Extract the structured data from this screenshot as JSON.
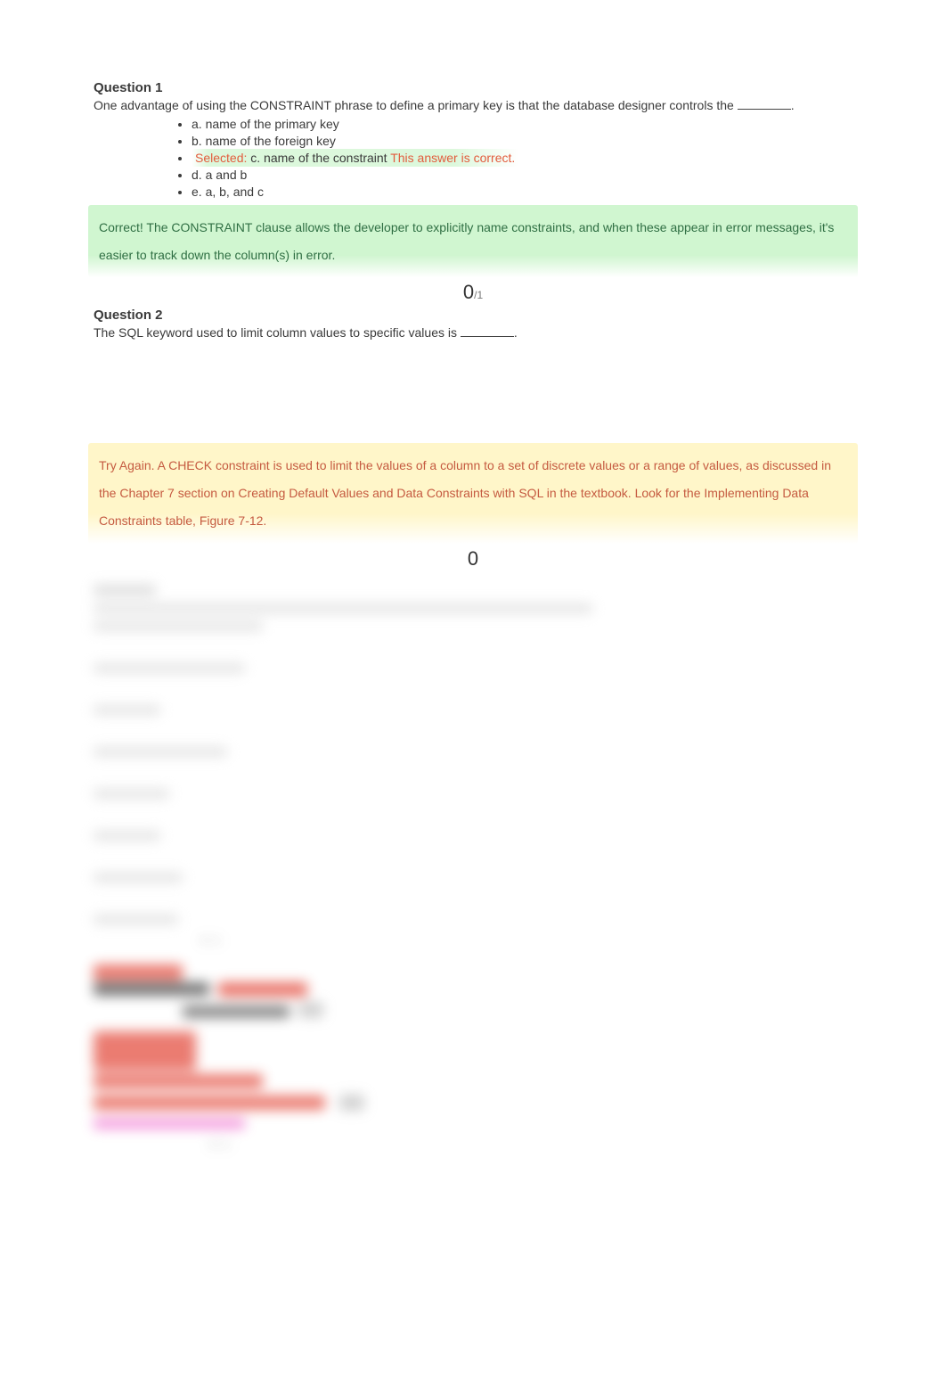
{
  "question1": {
    "title": "Question 1",
    "prompt_before": "One advantage of using the CONSTRAINT phrase to define a primary key is that the database designer controls the ",
    "prompt_after": ".",
    "choices": {
      "a": "a. name of the primary key",
      "b": "b. name of the foreign key",
      "selected_prefix": "Selected:",
      "c": "c. name of the constraint",
      "c_note": "This answer is correct.",
      "d": "d. a and b",
      "e": "e. a, b, and c"
    },
    "feedback": "Correct! The CONSTRAINT clause allows the developer to explicitly name constraints, and when these appear in error messages, it's easier to track down the column(s) in error.",
    "score_big": "0",
    "score_small": "/1"
  },
  "question2": {
    "title": "Question 2",
    "prompt_before": "The SQL keyword used to limit column values to specific values is ",
    "prompt_after": ".",
    "feedback": "Try Again. A CHECK constraint is used to limit the values of a column to a set of discrete values or a range of values, as discussed in the Chapter 7 section on Creating Default Values and Data Constraints with SQL in the textbook. Look for the Implementing Data Constraints table, Figure 7-12.",
    "score_big": "0"
  }
}
